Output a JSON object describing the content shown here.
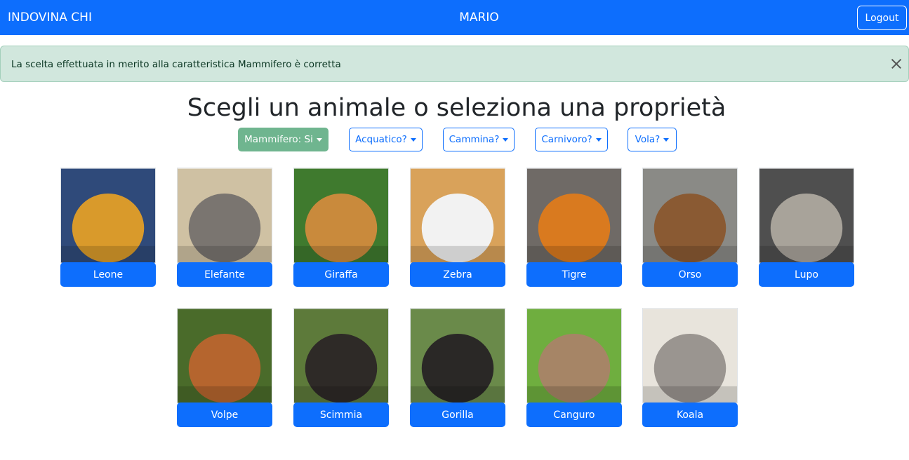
{
  "navbar": {
    "brand": "INDOVINA CHI",
    "user": "MARIO",
    "logout_label": "Logout"
  },
  "alert": {
    "message": "La scelta effettuata in merito alla caratteristica Mammifero è corretta"
  },
  "heading": "Scegli un animale o seleziona una proprietà",
  "properties": [
    {
      "label": "Mammifero: Si",
      "active": true
    },
    {
      "label": "Acquatico?",
      "active": false
    },
    {
      "label": "Cammina?",
      "active": false
    },
    {
      "label": "Carnivoro?",
      "active": false
    },
    {
      "label": "Vola?",
      "active": false
    }
  ],
  "animals": [
    {
      "name": "Leone",
      "icon": "lion-photo",
      "colors": [
        "#2f4a7a",
        "#d99a2b"
      ]
    },
    {
      "name": "Elefante",
      "icon": "elephant-photo",
      "colors": [
        "#cfc1a3",
        "#7a7570"
      ]
    },
    {
      "name": "Giraffa",
      "icon": "giraffe-photo",
      "colors": [
        "#3f7a2e",
        "#c98a3c"
      ]
    },
    {
      "name": "Zebra",
      "icon": "zebra-photo",
      "colors": [
        "#d9a25a",
        "#f2f2f2"
      ]
    },
    {
      "name": "Tigre",
      "icon": "tiger-photo",
      "colors": [
        "#6f6a66",
        "#d97a1f"
      ]
    },
    {
      "name": "Orso",
      "icon": "bear-photo",
      "colors": [
        "#8a8a86",
        "#8a5a33"
      ]
    },
    {
      "name": "Lupo",
      "icon": "wolf-photo",
      "colors": [
        "#4f4f4f",
        "#a8a39a"
      ]
    },
    {
      "name": "Volpe",
      "icon": "fox-photo",
      "colors": [
        "#4a6b2a",
        "#b5652e"
      ]
    },
    {
      "name": "Scimmia",
      "icon": "chimp-photo",
      "colors": [
        "#5d7a3a",
        "#2e2a27"
      ]
    },
    {
      "name": "Gorilla",
      "icon": "gorilla-photo",
      "colors": [
        "#6a8a4a",
        "#2a2826"
      ]
    },
    {
      "name": "Canguro",
      "icon": "kangaroo-photo",
      "colors": [
        "#6fae3f",
        "#a68566"
      ]
    },
    {
      "name": "Koala",
      "icon": "koala-photo",
      "colors": [
        "#e8e4dc",
        "#9a9590"
      ]
    }
  ]
}
